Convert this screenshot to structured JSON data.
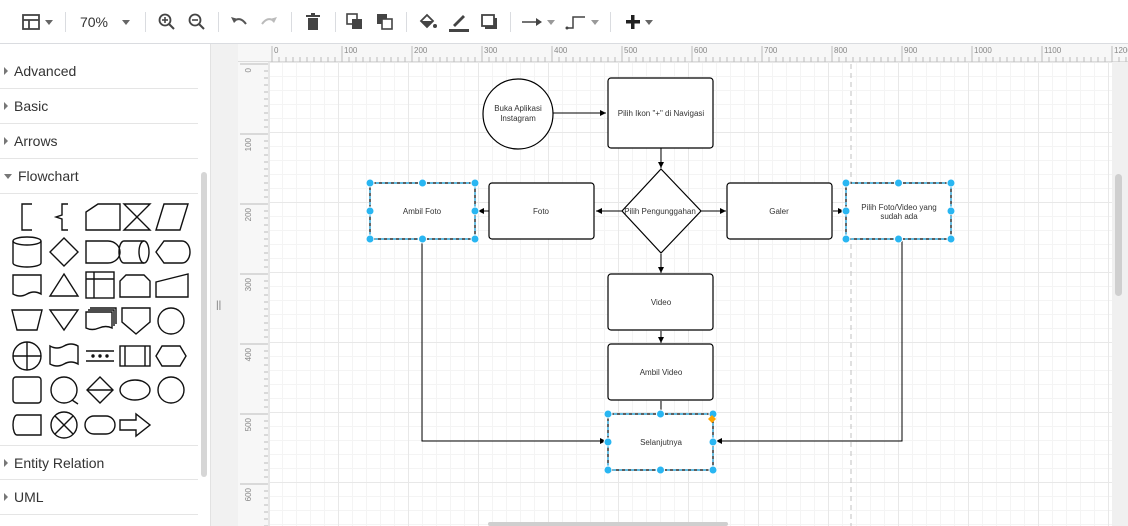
{
  "toolbar": {
    "zoom": "70%",
    "buttons": [
      "layout-icon",
      "zoom-in-icon",
      "zoom-out-icon",
      "undo-icon",
      "redo-icon",
      "delete-icon",
      "to-front-icon",
      "to-back-icon",
      "fill-color-icon",
      "line-color-icon",
      "shadow-icon",
      "connection-icon",
      "waypoint-icon",
      "insert-icon"
    ]
  },
  "sidebar": {
    "sections": [
      {
        "label": "Advanced",
        "open": false
      },
      {
        "label": "Basic",
        "open": false
      },
      {
        "label": "Arrows",
        "open": false
      },
      {
        "label": "Flowchart",
        "open": true
      },
      {
        "label": "Entity Relation",
        "open": false
      },
      {
        "label": "UML",
        "open": false
      }
    ]
  },
  "rulers": {
    "top": [
      "0",
      "100",
      "200",
      "300",
      "400",
      "500",
      "600",
      "700",
      "800",
      "900",
      "1000",
      "1100",
      "1200"
    ],
    "left": [
      "0",
      "100",
      "200",
      "300",
      "400",
      "500",
      "600"
    ]
  },
  "diagram": {
    "start": "Buka Aplikasi Instagram",
    "nav": "Pilih Ikon \"+\" di Navigasi",
    "decision": "Pilih Pengunggahan",
    "foto": "Foto",
    "galer": "Galer",
    "ambil_foto": "Ambil Foto",
    "pilih_foto": "Pilih Foto/Video yang sudah ada",
    "video": "Video",
    "ambil_video": "Ambil Video",
    "selanjutnya": "Selanjutnya"
  },
  "colors": {
    "selection": "#29b6f2",
    "handle_orange": "#ffa500",
    "stroke": "#000000"
  }
}
